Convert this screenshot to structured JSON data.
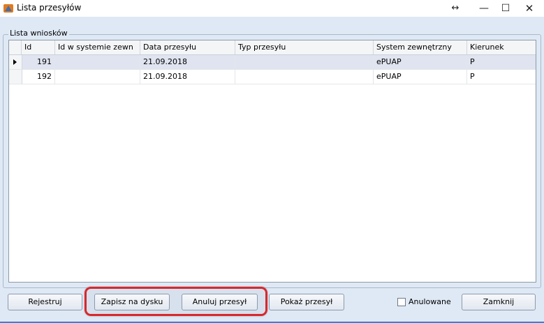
{
  "window": {
    "title": "Lista przesyłów",
    "resize_glyph": "↔",
    "minimize_glyph": "—",
    "maximize_glyph": "☐",
    "close_glyph": "✕"
  },
  "group": {
    "label": "Lista wniosków"
  },
  "grid": {
    "columns": [
      "Id",
      "Id w systemie zewn",
      "Data przesyłu",
      "Typ przesyłu",
      "System zewnętrzny",
      "Kierunek"
    ],
    "rows": [
      {
        "id": "191",
        "ext_id": "",
        "date": "21.09.2018",
        "type": "",
        "system": "ePUAP",
        "direction": "P"
      },
      {
        "id": "192",
        "ext_id": "",
        "date": "21.09.2018",
        "type": "",
        "system": "ePUAP",
        "direction": "P"
      }
    ]
  },
  "buttons": {
    "register": "Rejestruj",
    "save_to_disk": "Zapisz na dysku",
    "cancel_transfer": "Anuluj przesył",
    "show_transfer": "Pokaż przesył",
    "cancelled_label": "Anulowane",
    "close": "Zamknij"
  },
  "colors": {
    "highlight": "#d8282c",
    "selected_row": "#dfe4f0",
    "background": "#dfe9f5"
  }
}
